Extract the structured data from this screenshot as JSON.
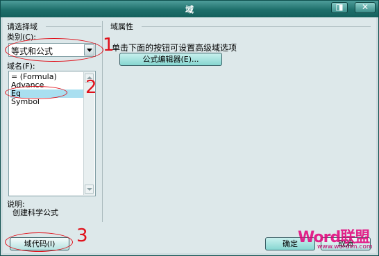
{
  "window": {
    "title": "域"
  },
  "left": {
    "group_title": "请选择域",
    "category_label": "类别(C):",
    "category_value": "等式和公式",
    "fieldname_label": "域名(F):",
    "fields": [
      "= (Formula)",
      "Advance",
      "Eq",
      "Symbol"
    ],
    "selected_field": "Eq",
    "description_label": "说明:",
    "description_text": "创建科学公式"
  },
  "right": {
    "group_title": "域属性",
    "hint": "单击下面的按钮可设置高级域选项",
    "editor_button": "公式编辑器(E)..."
  },
  "buttons": {
    "field_codes": "域代码(I)",
    "ok": "确定",
    "cancel": "取消"
  },
  "annotations": {
    "n1": "1",
    "n2": "2",
    "n3": "3"
  },
  "watermark": {
    "logo": "Word联盟",
    "url": "www.wordlm.com"
  },
  "colors": {
    "title_bar": "#1e6f6b",
    "annotation": "#e0101a",
    "selection": "#a9dff0"
  }
}
